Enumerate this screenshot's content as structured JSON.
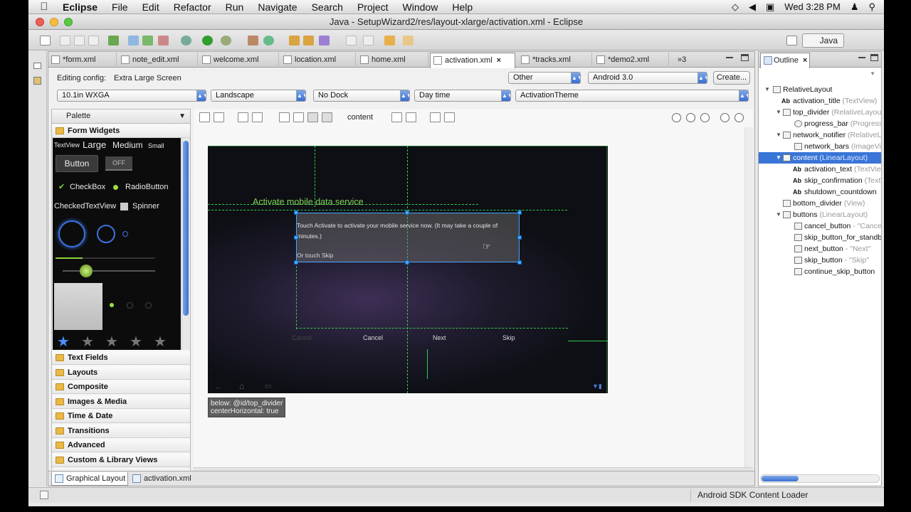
{
  "menubar": {
    "app": "Eclipse",
    "items": [
      "File",
      "Edit",
      "Refactor",
      "Run",
      "Navigate",
      "Search",
      "Project",
      "Window",
      "Help"
    ],
    "clock": "Wed 3:28 PM"
  },
  "window": {
    "title": "Java - SetupWizard2/res/layout-xlarge/activation.xml - Eclipse"
  },
  "toolbar": {
    "perspective": "Java"
  },
  "editor_tabs": [
    {
      "label": "*form.xml"
    },
    {
      "label": "note_edit.xml"
    },
    {
      "label": "welcome.xml"
    },
    {
      "label": "location.xml"
    },
    {
      "label": "home.xml"
    },
    {
      "label": "activation.xml"
    },
    {
      "label": "*tracks.xml"
    },
    {
      "label": "*demo2.xml"
    },
    {
      "label": "3"
    }
  ],
  "config": {
    "editing_label": "Editing config:",
    "editing_value": "Extra Large Screen",
    "other": "Other",
    "android_version": "Android 3.0",
    "create_label": "Create...",
    "device": "10.1in WXGA",
    "orientation": "Landscape",
    "dock": "No Dock",
    "daytime": "Day time",
    "theme": "ActivationTheme"
  },
  "palette": {
    "title": "Palette",
    "open_category": "Form Widgets",
    "widgets": {
      "textview": "TextView",
      "large": "Large",
      "medium": "Medium",
      "small": "Small",
      "button": "Button",
      "toggle": "OFF",
      "checkbox": "CheckBox",
      "radio": "RadioButton",
      "checkedtextview": "CheckedTextView",
      "spinner": "Spinner"
    },
    "categories": [
      "Text Fields",
      "Layouts",
      "Composite",
      "Images & Media",
      "Time & Date",
      "Transitions",
      "Advanced",
      "Custom & Library Views"
    ]
  },
  "canvas": {
    "selected_label": "content",
    "device": {
      "title": "Activate mobile data service",
      "body": "Touch Activate to activate your mobile service now. (It may take a couple of minutes.)",
      "skip_hint": "Or touch Skip",
      "buttons": {
        "cancel_ghost": "Cancel",
        "cancel": "Cancel",
        "next": "Next",
        "skip": "Skip"
      }
    },
    "hint_line1": "below: @id/top_divider",
    "hint_line2": "centerHorizontal: true"
  },
  "bottom_tabs": {
    "graphical": "Graphical Layout",
    "xml": "activation.xml"
  },
  "outline": {
    "title": "Outline",
    "rows": [
      {
        "name": "RelativeLayout",
        "hint": ""
      },
      {
        "name": "activation_title",
        "hint": " (TextView)"
      },
      {
        "name": "top_divider",
        "hint": " (RelativeLayout)"
      },
      {
        "name": "progress_bar",
        "hint": " (ProgressBar)"
      },
      {
        "name": "network_notifier",
        "hint": " (RelativeLayout)"
      },
      {
        "name": "network_bars",
        "hint": " (ImageView)"
      },
      {
        "name": "content",
        "hint": " (LinearLayout)"
      },
      {
        "name": "activation_text",
        "hint": " (TextView)"
      },
      {
        "name": "skip_confirmation",
        "hint": " (TextView)"
      },
      {
        "name": "shutdown_countdown",
        "hint": ""
      },
      {
        "name": "bottom_divider",
        "hint": " (View)"
      },
      {
        "name": "buttons",
        "hint": " (LinearLayout)"
      },
      {
        "name": "cancel_button",
        "hint": " - \"Cancel\""
      },
      {
        "name": "skip_button_for_standby",
        "hint": ""
      },
      {
        "name": "next_button",
        "hint": " - \"Next\""
      },
      {
        "name": "skip_button",
        "hint": " - \"Skip\""
      },
      {
        "name": "continue_skip_button",
        "hint": ""
      }
    ]
  },
  "status": {
    "text": "Android SDK Content Loader"
  },
  "colors": {
    "selection": "#3875d7",
    "guide": "#2ecb4c",
    "handle": "#4aa6ff"
  }
}
